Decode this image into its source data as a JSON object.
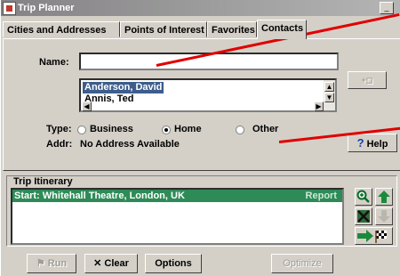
{
  "window": {
    "title": "Trip Planner"
  },
  "tabs": [
    {
      "label": "Cities and Addresses"
    },
    {
      "label": "Points of Interest"
    },
    {
      "label": "Favorites"
    },
    {
      "label": "Contacts"
    }
  ],
  "contacts": {
    "name_label": "Name:",
    "name_value": "",
    "list_items": [
      "Anderson, David",
      "Annis, Ted"
    ],
    "selected_index": 0,
    "type_label": "Type:",
    "type_options": [
      "Business",
      "Home",
      "Other"
    ],
    "type_selected": "Home",
    "addr_label": "Addr:",
    "addr_value": "No Address Available",
    "help_label": "Help",
    "help_glyph": "?"
  },
  "itinerary": {
    "label": "Trip Itinerary",
    "rows": [
      {
        "text": "Start: Whitehall Theatre, London, UK",
        "status": "Report"
      }
    ]
  },
  "toolbar": {
    "run_label": "Run",
    "clear_label": "Clear",
    "options_label": "Options",
    "optimize_label": "Optimize"
  },
  "colors": {
    "selection": "#3d5d8c",
    "itinerary_row": "#2e8b57",
    "annotation": "#e00000"
  }
}
